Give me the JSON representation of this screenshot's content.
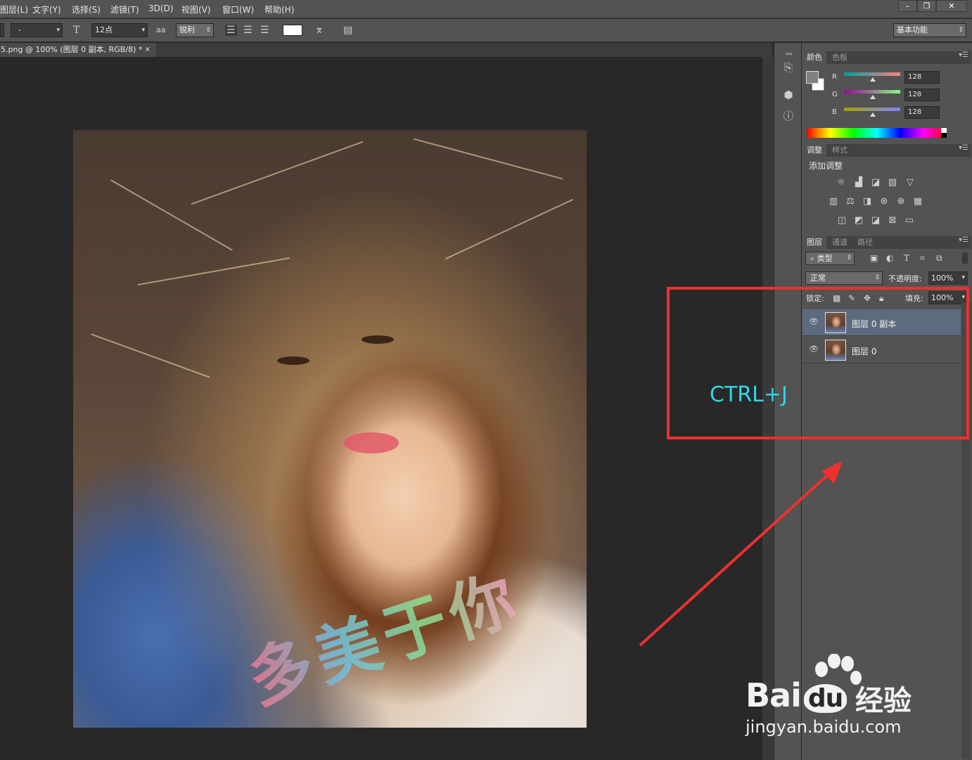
{
  "menubar": {
    "items": [
      "图层(L)",
      "文字(Y)",
      "选择(S)",
      "滤镜(T)",
      "3D(D)",
      "视图(V)",
      "窗口(W)",
      "帮助(H)"
    ],
    "window_buttons": [
      "–",
      "❐",
      "✕"
    ]
  },
  "options": {
    "font_style": "-",
    "font_size_icon": "T",
    "font_size": "12点",
    "antialias_icon": "aa",
    "antialias": "锐利",
    "workspace": "基本功能"
  },
  "document_tab": {
    "title": "5.png @ 100% (图层 0 副本, RGB/8) *",
    "close": "×"
  },
  "photo_overlay_text": "多美于你",
  "color_panel": {
    "tabs": [
      "颜色",
      "色板"
    ],
    "channels": [
      {
        "label": "R",
        "value": "128"
      },
      {
        "label": "G",
        "value": "128"
      },
      {
        "label": "B",
        "value": "128"
      }
    ]
  },
  "adjust_panel": {
    "tabs": [
      "调整",
      "样式"
    ],
    "title": "添加调整",
    "row1": [
      "☼",
      "▟",
      "◪",
      "▨",
      "▽"
    ],
    "row2": [
      "▥",
      "⚖",
      "◨",
      "⊛",
      "⊕",
      "▦"
    ],
    "row3": [
      "◫",
      "◩",
      "◪",
      "⊠",
      "▭"
    ]
  },
  "layers_panel": {
    "tabs": [
      "图层",
      "通道",
      "路径"
    ],
    "filter_kind": "类型",
    "blend_mode": "正常",
    "opacity_label": "不透明度:",
    "opacity": "100%",
    "lock_label": "锁定:",
    "fill_label": "填充:",
    "fill": "100%",
    "layers": [
      {
        "name": "图层 0 副本",
        "selected": true
      },
      {
        "name": "图层 0",
        "selected": false
      }
    ]
  },
  "annotation": {
    "shortcut": "CTRL+J",
    "color": "#ee3030",
    "text_color": "#2fd7e6"
  },
  "watermark": {
    "brand": "Bai",
    "brand2": "du",
    "jingyan": "经验",
    "url": "jingyan.baidu.com"
  }
}
